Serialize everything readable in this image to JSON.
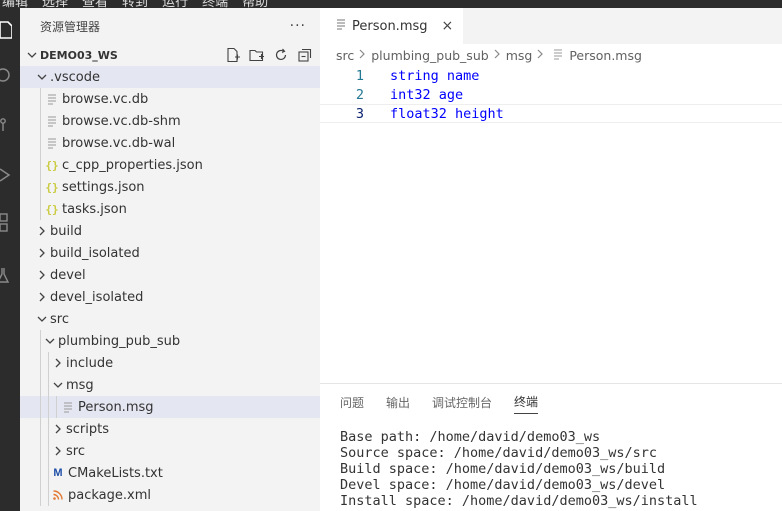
{
  "menubar": {
    "items": [
      "编辑",
      "选择",
      "查看",
      "转到",
      "运行",
      "终端",
      "帮助"
    ]
  },
  "sidebar": {
    "title": "资源管理器",
    "more": "···",
    "workspace": "DEMO03_WS",
    "tree": [
      {
        "label": ".vscode",
        "type": "folder",
        "open": true
      },
      {
        "label": "browse.vc.db",
        "type": "file"
      },
      {
        "label": "browse.vc.db-shm",
        "type": "file"
      },
      {
        "label": "browse.vc.db-wal",
        "type": "file"
      },
      {
        "label": "c_cpp_properties.json",
        "type": "json"
      },
      {
        "label": "settings.json",
        "type": "json"
      },
      {
        "label": "tasks.json",
        "type": "json"
      },
      {
        "label": "build",
        "type": "folder",
        "open": false
      },
      {
        "label": "build_isolated",
        "type": "folder",
        "open": false
      },
      {
        "label": "devel",
        "type": "folder",
        "open": false
      },
      {
        "label": "devel_isolated",
        "type": "folder",
        "open": false
      },
      {
        "label": "src",
        "type": "folder",
        "open": true
      },
      {
        "label": "plumbing_pub_sub",
        "type": "folder",
        "open": true
      },
      {
        "label": "include",
        "type": "folder",
        "open": false
      },
      {
        "label": "msg",
        "type": "folder",
        "open": true
      },
      {
        "label": "Person.msg",
        "type": "file"
      },
      {
        "label": "scripts",
        "type": "folder",
        "open": false
      },
      {
        "label": "src",
        "type": "folder",
        "open": false
      },
      {
        "label": "CMakeLists.txt",
        "type": "cmake"
      },
      {
        "label": "package.xml",
        "type": "xml"
      }
    ]
  },
  "editor": {
    "tab_label": "Person.msg",
    "tab_close": "×",
    "breadcrumb": [
      "src",
      "plumbing_pub_sub",
      "msg",
      "Person.msg"
    ],
    "lines": [
      {
        "num": "1",
        "text": "string name"
      },
      {
        "num": "2",
        "text": "int32 age"
      },
      {
        "num": "3",
        "text": "float32 height"
      }
    ]
  },
  "panel": {
    "tabs": [
      "问题",
      "输出",
      "调试控制台",
      "终端"
    ],
    "active_tab": "终端",
    "terminal_lines": [
      "Base path: /home/david/demo03_ws",
      "Source space: /home/david/demo03_ws/src",
      "Build space: /home/david/demo03_ws/build",
      "Devel space: /home/david/demo03_ws/devel",
      "Install space: /home/david/demo03_ws/install"
    ]
  },
  "colors": {
    "keyword": "#0000ff",
    "line_number": "#237893",
    "selection": "#e4e6f1",
    "activity_bar": "#2c2c2c"
  }
}
